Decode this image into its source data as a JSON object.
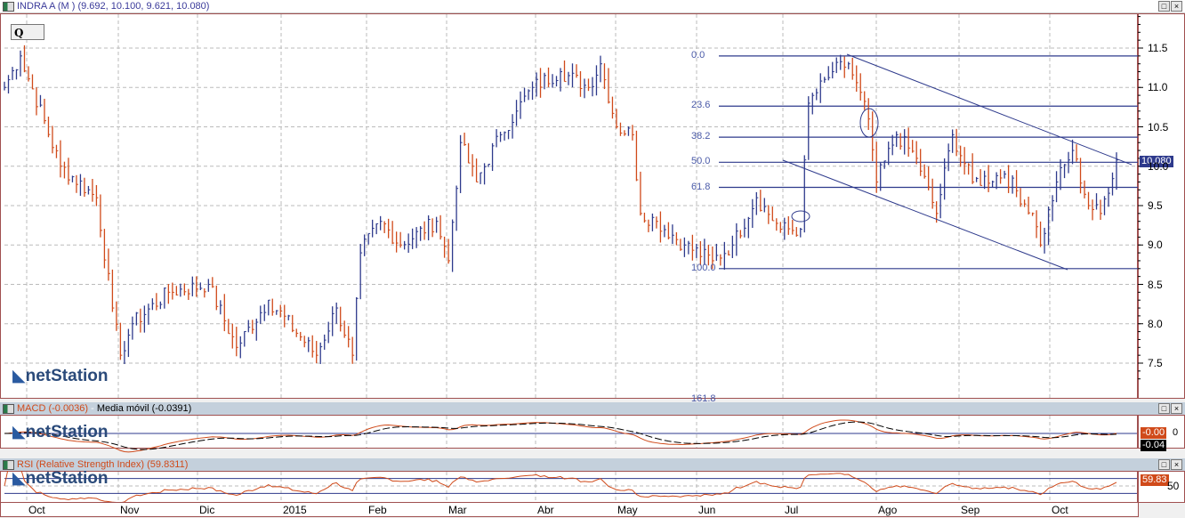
{
  "main": {
    "title": "INDRA A (M ) (9.692, 10.100, 9.621, 10.080)",
    "q_label": "Q",
    "logo": "netStation",
    "last_price": "10.080",
    "y_ticks": [
      "11.5",
      "11.0",
      "10.5",
      "10.0",
      "9.5",
      "9.0",
      "8.5",
      "8.0",
      "7.5"
    ],
    "fib_labels": [
      "0.0",
      "23.6",
      "38.2",
      "50.0",
      "61.8",
      "100.0",
      "161.8"
    ]
  },
  "macd": {
    "title_macd": "MACD (-0.0036)",
    "title_sep": " - ",
    "title_ma": "Media móvil (-0.0391)",
    "macd_tag": "-0.00",
    "signal_tag": "-0.04",
    "zero_label": "0",
    "logo": "netStation"
  },
  "rsi": {
    "title": "RSI (Relative Strength Index) (59.8311)",
    "tag": "59.83",
    "label_50": "50",
    "logo": "netStation"
  },
  "x_axis": {
    "months": [
      "Oct",
      "Nov",
      "Dic",
      "2015",
      "Feb",
      "Mar",
      "Abr",
      "May",
      "Jun",
      "Jul",
      "Ago",
      "Sep",
      "Oct"
    ]
  },
  "window_buttons": {
    "maximize": "□",
    "close": "×"
  },
  "colors": {
    "up": "#2e3a8c",
    "down": "#d04a1a",
    "frame": "#a05050"
  },
  "chart_data": {
    "type": "ohlc",
    "symbol": "INDRA A",
    "ylim": [
      7.2,
      11.9
    ],
    "anchors_day_close": [
      [
        0,
        11.0
      ],
      [
        4,
        11.4
      ],
      [
        14,
        10.0
      ],
      [
        23,
        9.6
      ],
      [
        27,
        8.2
      ],
      [
        29,
        7.6
      ],
      [
        32,
        8.0
      ],
      [
        41,
        8.4
      ],
      [
        51,
        8.5
      ],
      [
        58,
        7.7
      ],
      [
        66,
        8.3
      ],
      [
        78,
        7.6
      ],
      [
        83,
        8.2
      ],
      [
        87,
        7.6
      ],
      [
        89,
        8.9
      ],
      [
        94,
        9.3
      ],
      [
        99,
        9.0
      ],
      [
        108,
        9.3
      ],
      [
        111,
        8.8
      ],
      [
        114,
        10.3
      ],
      [
        118,
        9.8
      ],
      [
        124,
        10.4
      ],
      [
        128,
        10.7
      ],
      [
        132,
        11.0
      ],
      [
        139,
        11.2
      ],
      [
        146,
        11.0
      ],
      [
        149,
        11.3
      ],
      [
        153,
        10.5
      ],
      [
        157,
        10.4
      ],
      [
        159,
        9.4
      ],
      [
        163,
        9.3
      ],
      [
        170,
        9.0
      ],
      [
        177,
        8.8
      ],
      [
        182,
        9.0
      ],
      [
        188,
        9.6
      ],
      [
        194,
        9.2
      ],
      [
        199,
        9.2
      ],
      [
        201,
        10.8
      ],
      [
        207,
        11.2
      ],
      [
        211,
        11.3
      ],
      [
        216,
        10.6
      ],
      [
        218,
        9.8
      ],
      [
        223,
        10.4
      ],
      [
        228,
        10.1
      ],
      [
        233,
        9.4
      ],
      [
        237,
        10.4
      ],
      [
        242,
        9.8
      ],
      [
        250,
        9.9
      ],
      [
        257,
        9.4
      ],
      [
        259,
        9.0
      ],
      [
        263,
        9.8
      ],
      [
        267,
        10.2
      ],
      [
        271,
        9.5
      ],
      [
        274,
        9.4
      ],
      [
        278,
        10.08
      ]
    ],
    "fibonacci": {
      "high": 11.4,
      "low": 8.7,
      "levels": [
        0,
        23.6,
        38.2,
        50,
        61.8,
        100,
        161.8
      ]
    },
    "last": {
      "open": 9.692,
      "high": 10.1,
      "low": 9.621,
      "close": 10.08
    },
    "indicators": {
      "macd": -0.0036,
      "macd_signal": -0.0391,
      "rsi": 59.8311
    }
  }
}
